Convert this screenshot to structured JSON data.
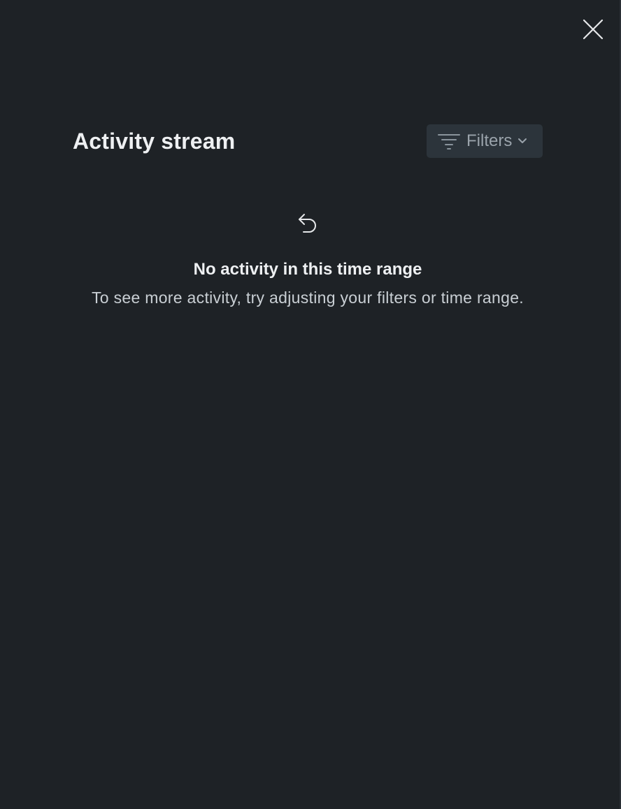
{
  "panel": {
    "close_icon": "close-icon"
  },
  "header": {
    "title": "Activity stream",
    "filters": {
      "label": "Filters",
      "icon": "filter-icon",
      "dropdown_icon": "chevron-down-icon"
    }
  },
  "empty_state": {
    "icon": "undo-arrow-icon",
    "title": "No activity in this time range",
    "description": "To see more activity, try adjusting your filters or time range."
  },
  "colors": {
    "background": "#1e2226",
    "button_background": "#2c343b",
    "title_text": "#eef0f2",
    "muted_text": "#9aa3ab",
    "body_text": "#c9cfd4"
  }
}
